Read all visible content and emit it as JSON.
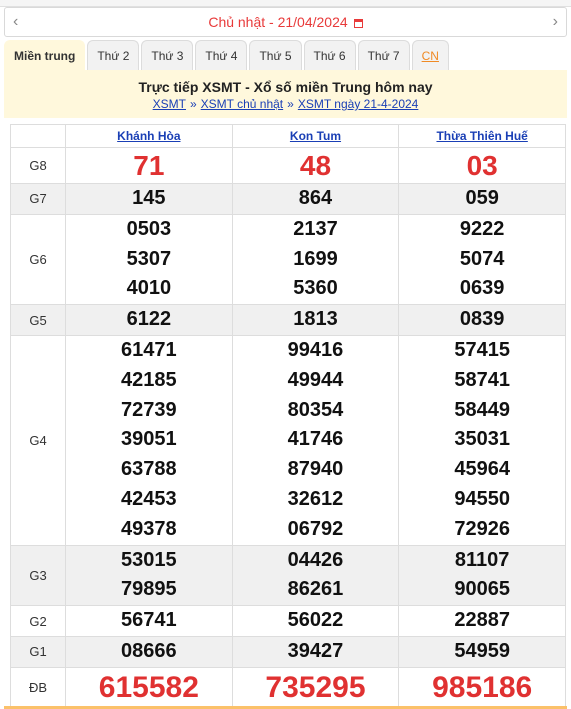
{
  "date_bar": {
    "text": "Chủ nhật -  21/04/2024",
    "prev_icon": "chevron-left",
    "next_icon": "chevron-right",
    "calendar_icon": "calendar"
  },
  "tabs": [
    "Miền trung",
    "Thứ 2",
    "Thứ 3",
    "Thứ 4",
    "Thứ 5",
    "Thứ 6",
    "Thứ 7",
    "CN"
  ],
  "header": {
    "title": "Trực tiếp XSMT - Xổ số miền Trung hôm nay",
    "breadcrumbs": [
      "XSMT",
      "XSMT chủ nhật",
      "XSMT ngày 21-4-2024"
    ],
    "separator": "»"
  },
  "provinces": [
    "Khánh Hòa",
    "Kon Tum",
    "Thừa Thiên Huế"
  ],
  "prizes": [
    {
      "label": "G8",
      "values": [
        [
          "71"
        ],
        [
          "48"
        ],
        [
          "03"
        ]
      ]
    },
    {
      "label": "G7",
      "values": [
        [
          "145"
        ],
        [
          "864"
        ],
        [
          "059"
        ]
      ]
    },
    {
      "label": "G6",
      "values": [
        [
          "0503",
          "5307",
          "4010"
        ],
        [
          "2137",
          "1699",
          "5360"
        ],
        [
          "9222",
          "5074",
          "0639"
        ]
      ]
    },
    {
      "label": "G5",
      "values": [
        [
          "6122"
        ],
        [
          "1813"
        ],
        [
          "0839"
        ]
      ]
    },
    {
      "label": "G4",
      "values": [
        [
          "61471",
          "42185",
          "72739",
          "39051",
          "63788",
          "42453",
          "49378"
        ],
        [
          "99416",
          "49944",
          "80354",
          "41746",
          "87940",
          "32612",
          "06792"
        ],
        [
          "57415",
          "58741",
          "58449",
          "35031",
          "45964",
          "94550",
          "72926"
        ]
      ]
    },
    {
      "label": "G3",
      "values": [
        [
          "53015",
          "79895"
        ],
        [
          "04426",
          "86261"
        ],
        [
          "81107",
          "90065"
        ]
      ]
    },
    {
      "label": "G2",
      "values": [
        [
          "56741"
        ],
        [
          "56022"
        ],
        [
          "22887"
        ]
      ]
    },
    {
      "label": "G1",
      "values": [
        [
          "08666"
        ],
        [
          "39427"
        ],
        [
          "54959"
        ]
      ]
    },
    {
      "label": "ĐB",
      "values": [
        [
          "615582"
        ],
        [
          "735295"
        ],
        [
          "985186"
        ]
      ]
    }
  ],
  "colors": {
    "accent_red": "#e03131",
    "header_bg": "#fff8dc",
    "link_blue": "#1a3fb5",
    "tab_cn": "#f08a24"
  }
}
